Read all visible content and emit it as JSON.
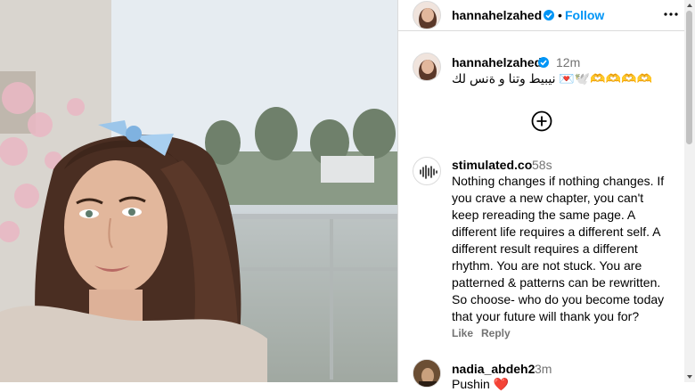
{
  "post": {
    "photo_alt": "Woman with long brown hair and a light blue bow on a balcony",
    "header": {
      "username": "hannahelzahed",
      "follow_label": "Follow",
      "separator": "•"
    },
    "caption": {
      "username": "hannahelzahed",
      "time": "12m",
      "text": "كل سنة و انتو طيبين 💌🕊️",
      "more_placeholder": "🫶🫶🫶🫶"
    },
    "comments": [
      {
        "username": "stimulated.co",
        "time": "58s",
        "lines": [
          "Nothing changes if nothing changes. If",
          "you crave a new chapter, you can't",
          "keep rereading the same page. A",
          "different life requires a different self. A",
          "different result requires a different",
          "rhythm. You are not stuck. You are",
          "patterned & patterns can be rewritten.",
          "So choose- who do you become today",
          "that your future will thank you for?"
        ],
        "like_label": "Like",
        "reply_label": "Reply"
      },
      {
        "username": "nadia_abdeh2",
        "time": "3m",
        "text": "Pushin ❤️"
      }
    ]
  },
  "colors": {
    "accent": "#0095f6",
    "muted": "#737373",
    "border": "#dbdbdb"
  },
  "icons": {
    "verified": "verified-badge-icon",
    "more": "more-options-icon",
    "add": "plus-circle-icon",
    "audio": "sound-wave-icon"
  }
}
